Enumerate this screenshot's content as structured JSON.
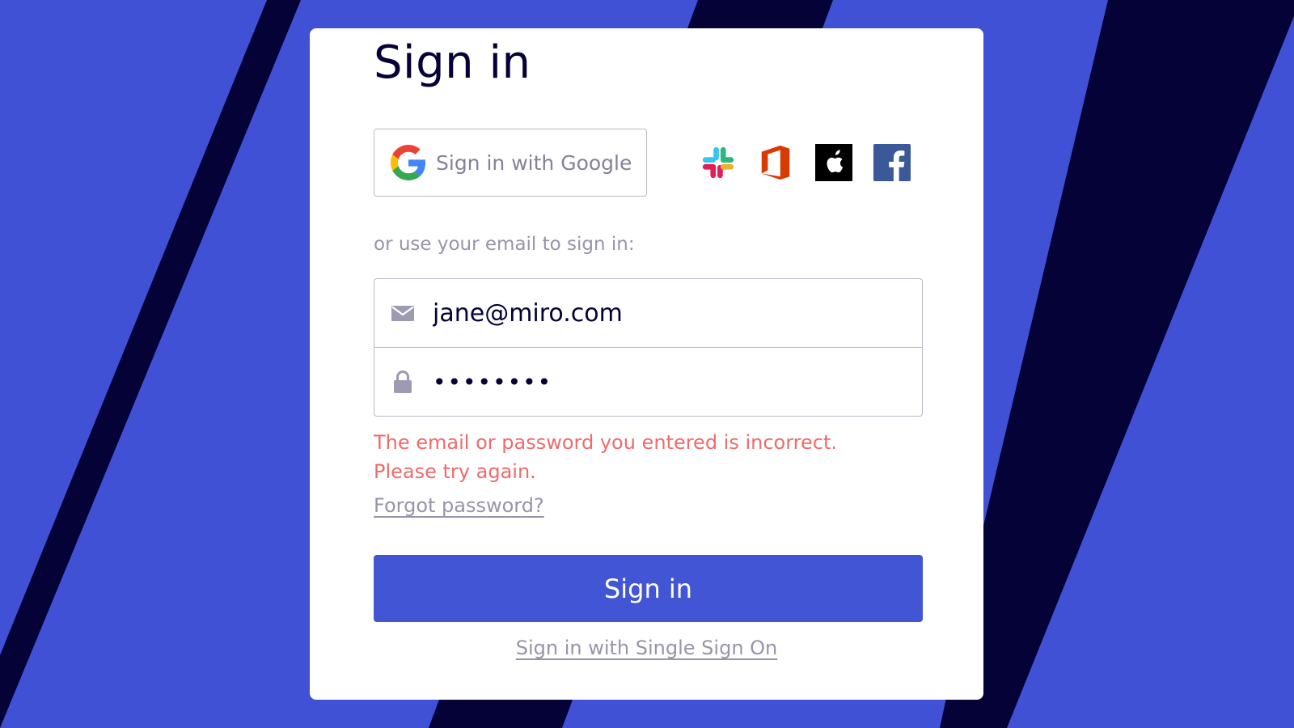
{
  "colors": {
    "background": "#4051d6",
    "stripe": "#040237",
    "primary_button": "#4255d4",
    "error": "#ef6b6b",
    "title": "#050038"
  },
  "signin": {
    "title": "Sign in",
    "google_button_label": "Sign in with Google",
    "social_providers": [
      "slack-icon",
      "office-icon",
      "apple-icon",
      "facebook-icon"
    ],
    "or_text": "or use your email to sign in:",
    "email_value": "jane@miro.com",
    "password_value": "••••••••",
    "error_line1": "The email or password you entered is incorrect.",
    "error_line2": "Please try again.",
    "forgot_link": "Forgot password?",
    "submit_label": "Sign in",
    "sso_link": "Sign in with Single Sign On"
  }
}
